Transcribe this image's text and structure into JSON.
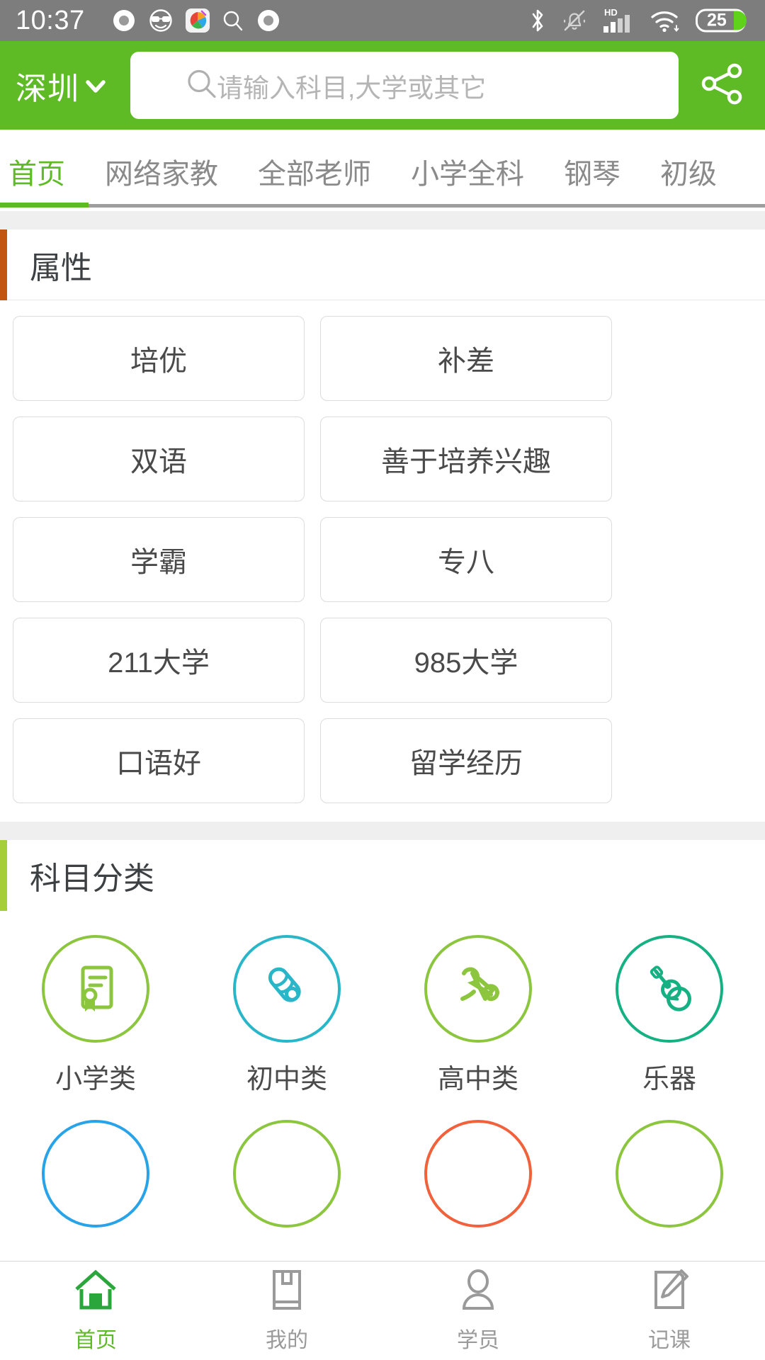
{
  "status_bar": {
    "time": "10:37",
    "left_icons": [
      "circle-record-icon",
      "sunglasses-face-icon",
      "colorful-app-icon",
      "search-icon",
      "circle-record-icon"
    ],
    "right_icons": [
      "bluetooth-icon",
      "mute-bell-icon",
      "hd-signal-icon",
      "wifi-icon"
    ],
    "battery_level": "25"
  },
  "header": {
    "city": "深圳",
    "city_chevron": "chevron-down-icon",
    "search_placeholder": "请输入科目,大学或其它",
    "search_value": "",
    "search_icon": "search-icon",
    "share_icon": "share-icon",
    "background_color": "#5fbb25"
  },
  "tabs": [
    {
      "label": "首页",
      "active": true
    },
    {
      "label": "网络家教",
      "active": false
    },
    {
      "label": "全部老师",
      "active": false
    },
    {
      "label": "小学全科",
      "active": false
    },
    {
      "label": "钢琴",
      "active": false
    },
    {
      "label": "初级",
      "active": false
    }
  ],
  "sections": [
    {
      "title": "属性",
      "accent_color": "#c2550f",
      "items": [
        "培优",
        "补差",
        "双语",
        "善于培养兴趣",
        "学霸",
        "专八",
        "211大学",
        "985大学",
        "口语好",
        "留学经历"
      ]
    },
    {
      "title": "科目分类",
      "accent_color": "#a6ce39",
      "categories": [
        {
          "label": "小学类",
          "icon": "diploma-certificate-icon",
          "color": "#8cc63f"
        },
        {
          "label": "初中类",
          "icon": "scroll-rolled-icon",
          "color": "#29b6c8"
        },
        {
          "label": "高中类",
          "icon": "graduation-scroll-icon",
          "color": "#8cc63f"
        },
        {
          "label": "乐器",
          "icon": "guitar-icon",
          "color": "#16b183"
        },
        {
          "label": "",
          "icon": "partial-circle-icon",
          "color": "#29a3e8"
        },
        {
          "label": "",
          "icon": "partial-circle-icon",
          "color": "#8cc63f"
        },
        {
          "label": "",
          "icon": "partial-circle-icon",
          "color": "#f0613c"
        },
        {
          "label": "",
          "icon": "partial-circle-icon",
          "color": "#8cc63f"
        }
      ]
    }
  ],
  "bottom_nav": [
    {
      "label": "首页",
      "icon": "home-icon",
      "active": true
    },
    {
      "label": "我的",
      "icon": "book-icon",
      "active": false
    },
    {
      "label": "学员",
      "icon": "person-icon",
      "active": false
    },
    {
      "label": "记课",
      "icon": "note-pencil-icon",
      "active": false
    }
  ],
  "colors": {
    "brand_green": "#5fbb25",
    "statusbar_gray": "#7d7d7d",
    "page_bg": "#efefef"
  }
}
